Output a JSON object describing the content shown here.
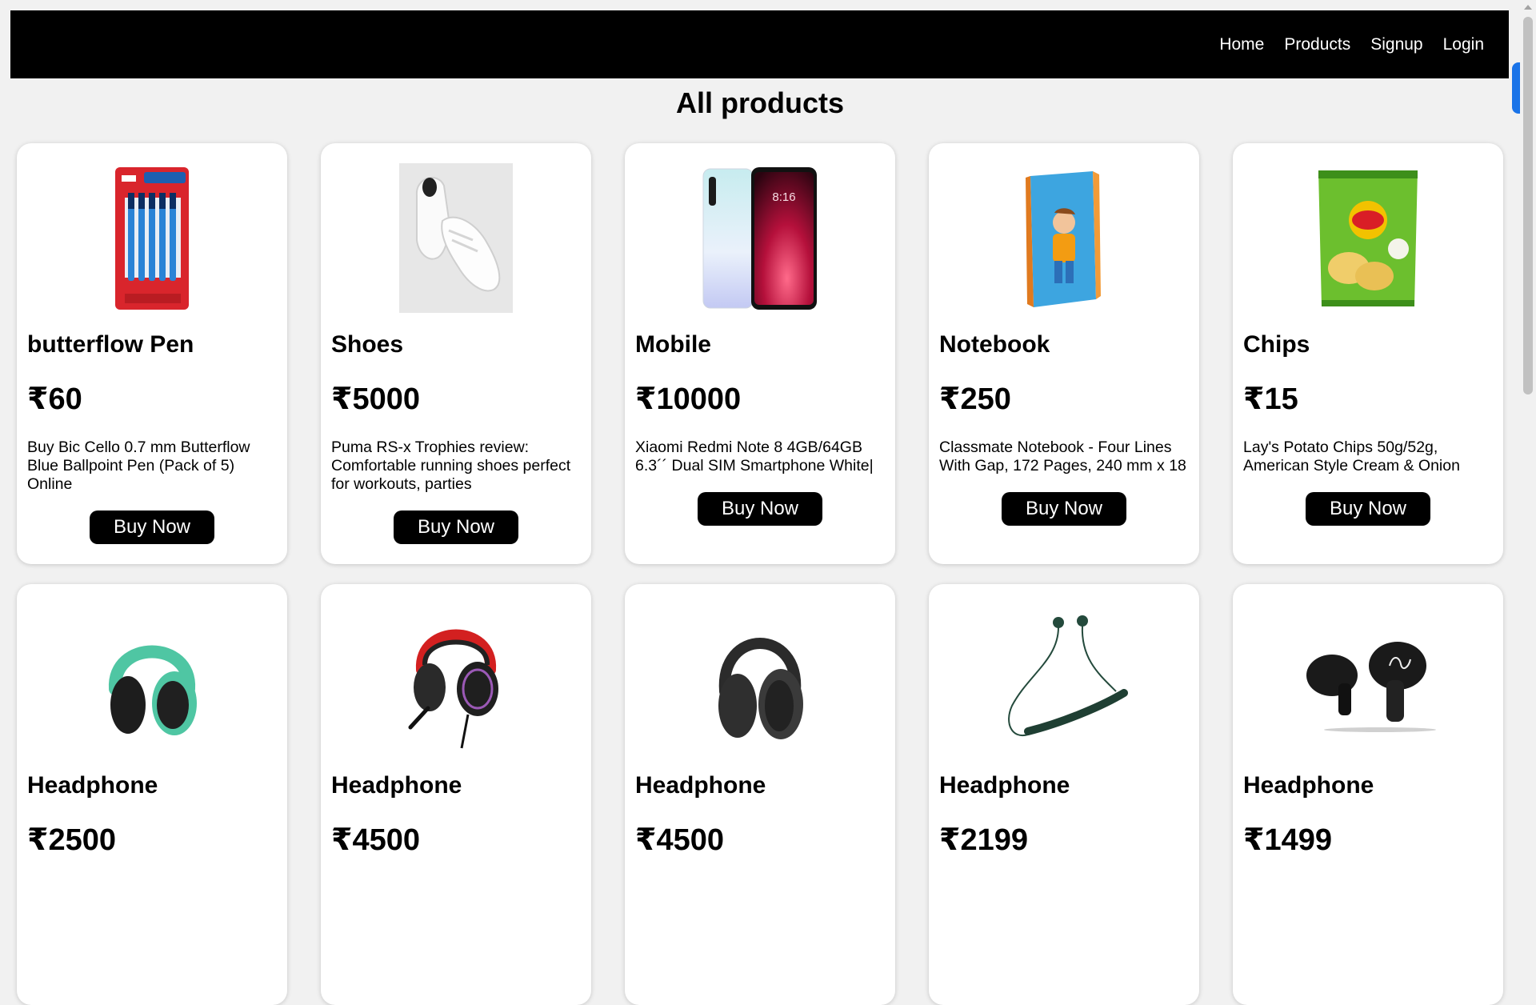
{
  "nav": {
    "links": [
      "Home",
      "Products",
      "Signup",
      "Login"
    ]
  },
  "page": {
    "title": "All products"
  },
  "products": [
    {
      "name": "butterflow Pen",
      "price": "₹60",
      "description": "Buy Bic Cello 0.7 mm Butterflow Blue Ballpoint Pen (Pack of 5) Online",
      "button": "Buy Now",
      "image": "pen-pack-image"
    },
    {
      "name": "Shoes",
      "price": "₹5000",
      "description": "Puma RS-x Trophies review: Comfortable running shoes perfect for workouts, parties",
      "button": "Buy Now",
      "image": "white-shoes-image"
    },
    {
      "name": "Mobile",
      "price": "₹10000",
      "description": "Xiaomi Redmi Note 8 4GB/64GB 6.3´´ Dual SIM Smartphone White|",
      "button": "Buy Now",
      "image": "smartphone-image"
    },
    {
      "name": "Notebook",
      "price": "₹250",
      "description": "Classmate Notebook - Four Lines With Gap, 172 Pages, 240 mm x 18",
      "button": "Buy Now",
      "image": "notebook-image"
    },
    {
      "name": "Chips",
      "price": "₹15",
      "description": "Lay's Potato Chips 50g/52g, American Style Cream & Onion",
      "button": "Buy Now",
      "image": "chips-pack-image"
    },
    {
      "name": "Headphone",
      "price": "₹2500",
      "description": "",
      "button": "",
      "image": "green-headphone-image"
    },
    {
      "name": "Headphone",
      "price": "₹4500",
      "description": "",
      "button": "",
      "image": "gaming-headset-image"
    },
    {
      "name": "Headphone",
      "price": "₹4500",
      "description": "",
      "button": "",
      "image": "black-headphone-image"
    },
    {
      "name": "Headphone",
      "price": "₹2199",
      "description": "",
      "button": "",
      "image": "neckband-earphone-image"
    },
    {
      "name": "Headphone",
      "price": "₹1499",
      "description": "",
      "button": "",
      "image": "earbuds-image"
    }
  ],
  "product_image_text": {
    "mobile_time": "8:16"
  },
  "colors": {
    "navbar": "#000000",
    "button": "#000000",
    "background": "#f1f1f1",
    "card": "#ffffff"
  }
}
